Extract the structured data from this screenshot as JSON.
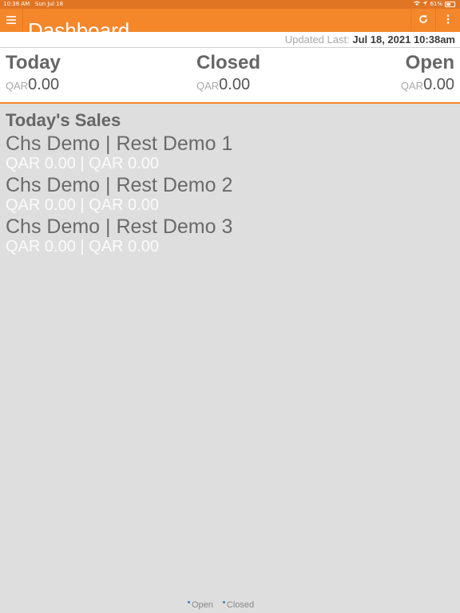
{
  "status_bar": {
    "time": "10:38 AM",
    "date": "Sun Jul 18",
    "battery": "61%"
  },
  "app_bar": {
    "title": "Dashboard",
    "menu_icon": "hamburger-menu-icon",
    "refresh_icon": "refresh-icon",
    "more_icon": "more-vertical-icon",
    "accent_color": "#f5872b"
  },
  "updated": {
    "label": "Updated Last:",
    "value": "Jul 18, 2021 10:38am"
  },
  "summary": [
    {
      "title": "Today",
      "currency": "QAR",
      "amount": "0.00"
    },
    {
      "title": "Closed",
      "currency": "QAR",
      "amount": "0.00"
    },
    {
      "title": "Open",
      "currency": "QAR",
      "amount": "0.00"
    }
  ],
  "sales": {
    "heading": "Today's Sales",
    "items": [
      {
        "name": "Chs Demo | Rest Demo 1",
        "amounts": "QAR 0.00 | QAR 0.00"
      },
      {
        "name": "Chs Demo | Rest Demo 2",
        "amounts": "QAR 0.00 | QAR 0.00"
      },
      {
        "name": "Chs Demo | Rest Demo 3",
        "amounts": "QAR 0.00 | QAR 0.00"
      }
    ]
  },
  "legend": {
    "items": [
      "Open",
      "Closed"
    ],
    "dot_color": "#3a7fc0"
  }
}
